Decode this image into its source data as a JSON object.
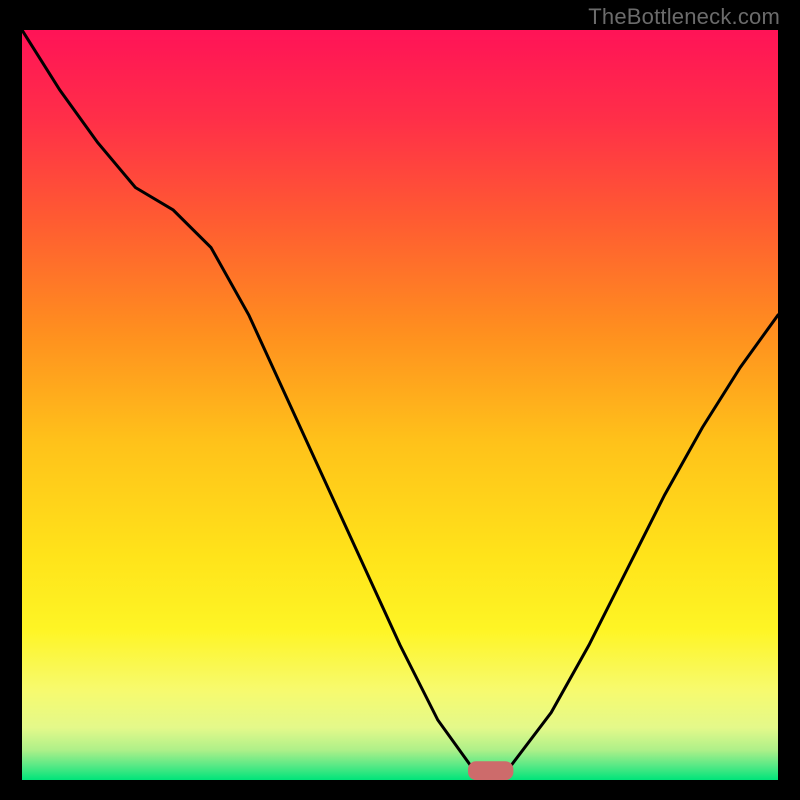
{
  "watermark": "TheBottleneck.com",
  "chart_data": {
    "type": "line",
    "title": "",
    "xlabel": "",
    "ylabel": "",
    "xlim": [
      0,
      100
    ],
    "ylim": [
      0,
      100
    ],
    "grid": false,
    "background_gradient": [
      "#ff1357",
      "#ff3a41",
      "#ff6d2a",
      "#ffa31a",
      "#ffd41a",
      "#feee1e",
      "#f9f965",
      "#d4f58a",
      "#00e47a"
    ],
    "series": [
      {
        "name": "bottleneck-curve",
        "x": [
          0,
          5,
          10,
          15,
          20,
          25,
          30,
          35,
          40,
          45,
          50,
          55,
          60,
          62,
          64,
          70,
          75,
          80,
          85,
          90,
          95,
          100
        ],
        "y": [
          100,
          92,
          85,
          79,
          76,
          71,
          62,
          51,
          40,
          29,
          18,
          8,
          1,
          0,
          1,
          9,
          18,
          28,
          38,
          47,
          55,
          62
        ]
      }
    ],
    "marker": {
      "x": 62,
      "y": 0,
      "width": 6,
      "height": 2.5,
      "color": "#cd6b6b"
    }
  }
}
